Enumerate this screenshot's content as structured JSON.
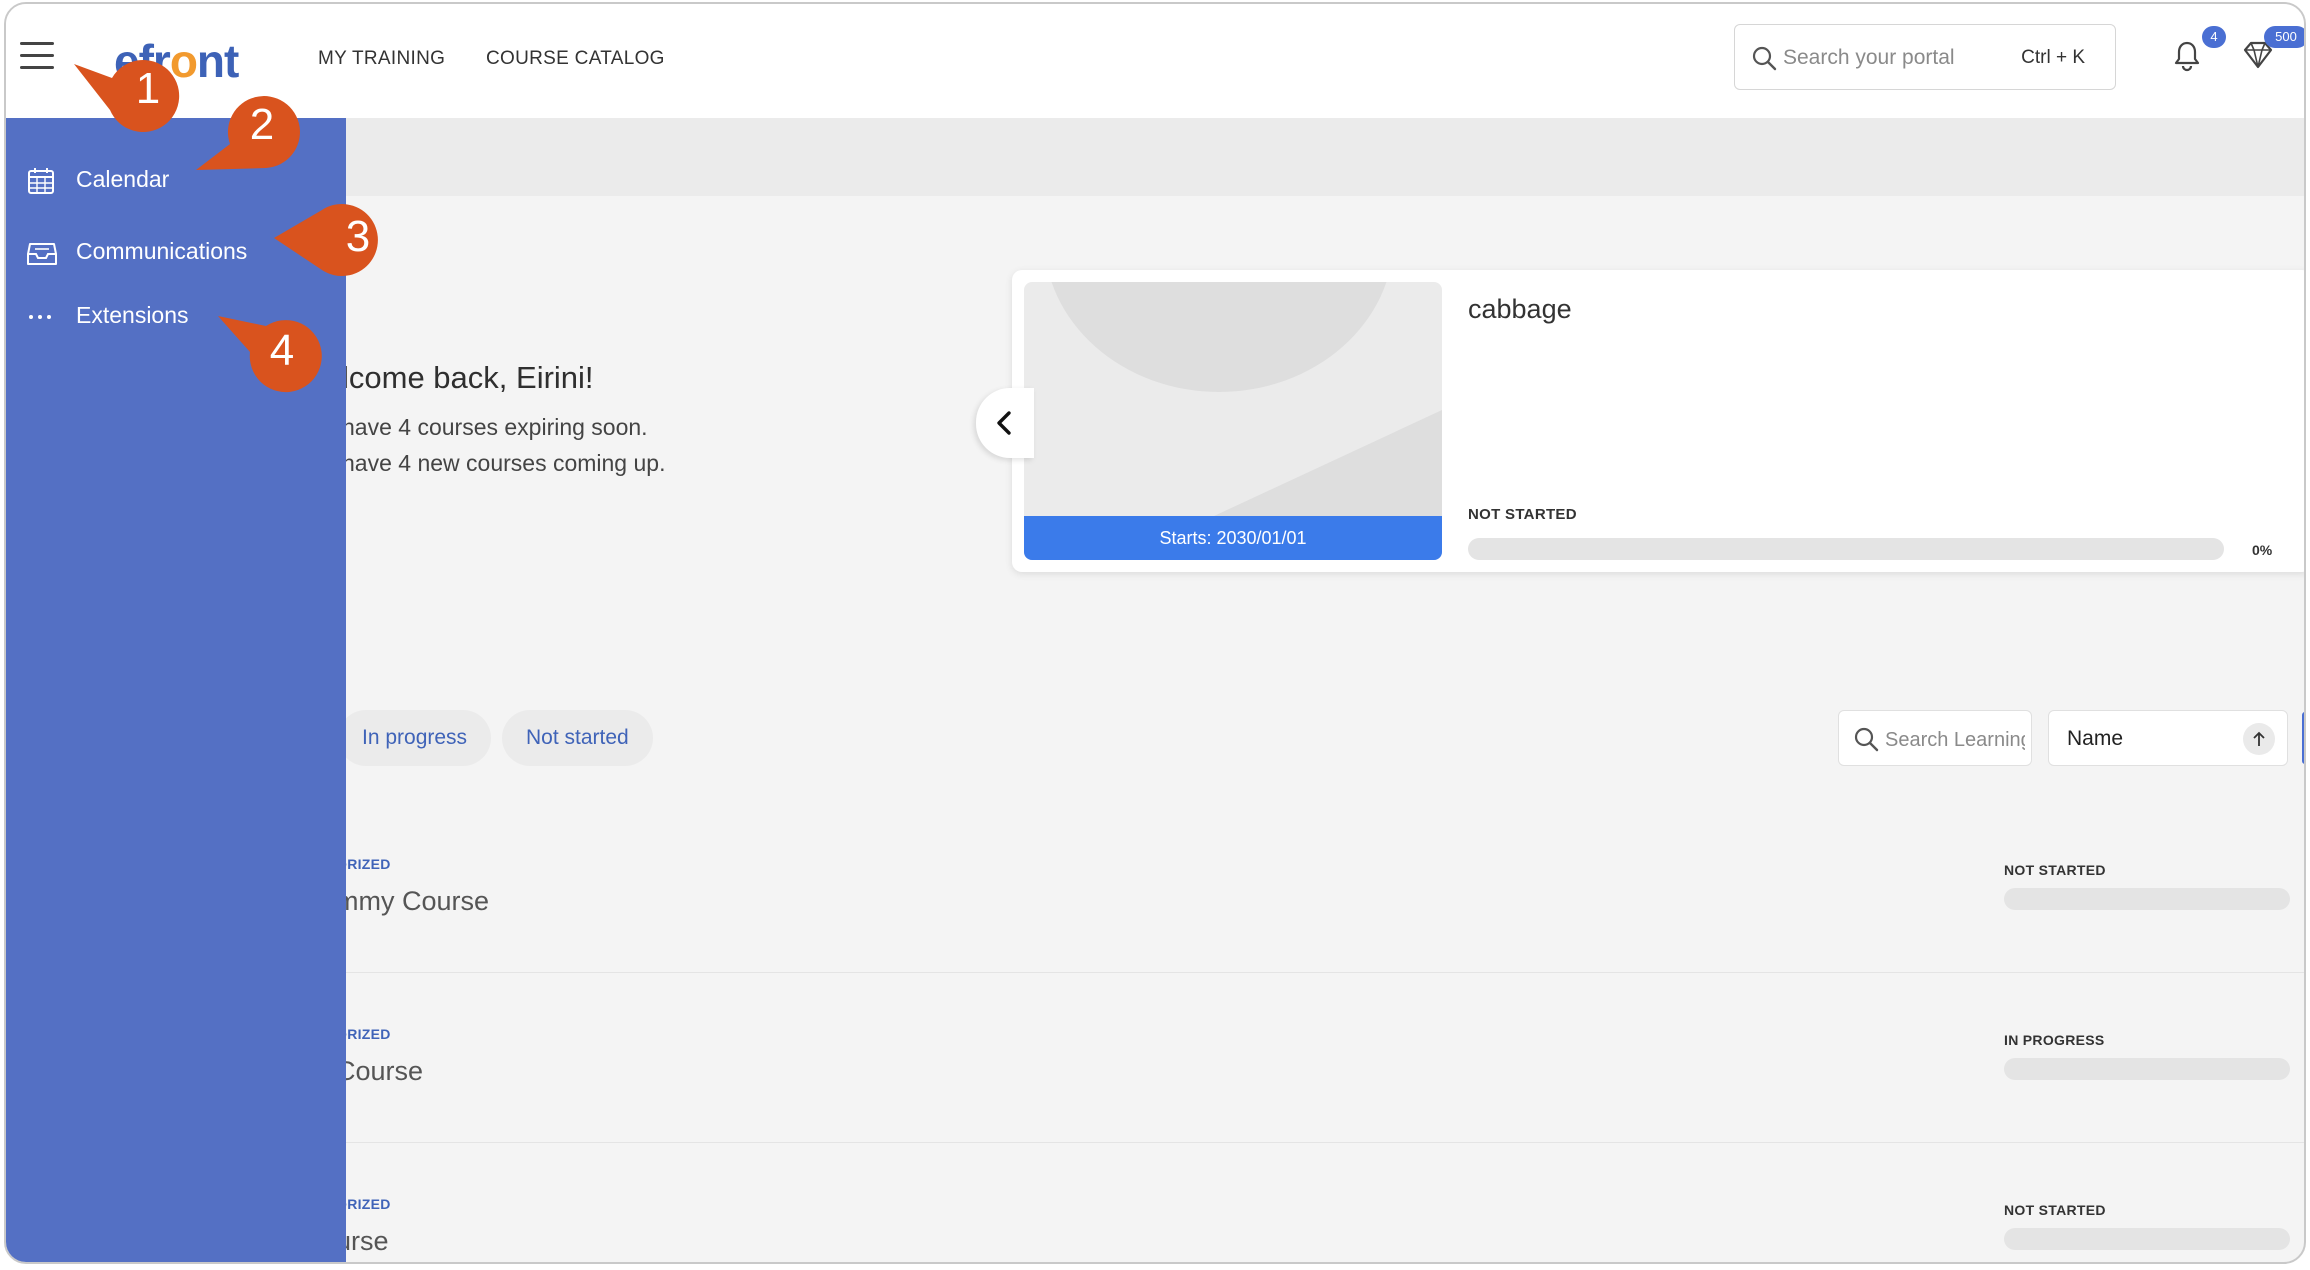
{
  "header": {
    "logo_text_a": "efr",
    "logo_text_b": "o",
    "logo_text_c": "nt",
    "nav": [
      "MY TRAINING",
      "COURSE CATALOG"
    ],
    "search_placeholder": "Search your portal",
    "search_shortcut": "Ctrl + K",
    "notifications_count": "4",
    "points_count": "500"
  },
  "sidebar": {
    "items": [
      {
        "label": "Calendar",
        "icon": "calendar-icon"
      },
      {
        "label": "Communications",
        "icon": "inbox-icon"
      },
      {
        "label": "Extensions",
        "icon": "more-horizontal-icon"
      }
    ]
  },
  "welcome": {
    "title": "lcome back, Eirini!",
    "line1": "have 4 courses expiring soon.",
    "line2": "have 4 new courses coming up."
  },
  "carousel": {
    "card": {
      "title": "cabbage",
      "date_label": "Starts: 2030/01/01",
      "status": "NOT STARTED",
      "progress": 0,
      "progress_label": "0%"
    }
  },
  "filters": {
    "pills": [
      "In progress",
      "Not started"
    ],
    "search_placeholder": "Search Learning",
    "sort_label": "Name"
  },
  "courses": [
    {
      "category": "ORIZED",
      "name": "mmy Course",
      "status": "NOT STARTED",
      "progress": 0
    },
    {
      "category": "ORIZED",
      "name": "Course",
      "status": "IN PROGRESS",
      "progress": 0
    },
    {
      "category": "ORIZED",
      "name": "urse",
      "status": "NOT STARTED",
      "progress": 0
    }
  ],
  "callouts": [
    "1",
    "2",
    "3",
    "4"
  ],
  "colors": {
    "sidebar": "#5470c4",
    "accent": "#3d62b7",
    "callout": "#d9531e",
    "date_banner": "#3b7bea"
  }
}
